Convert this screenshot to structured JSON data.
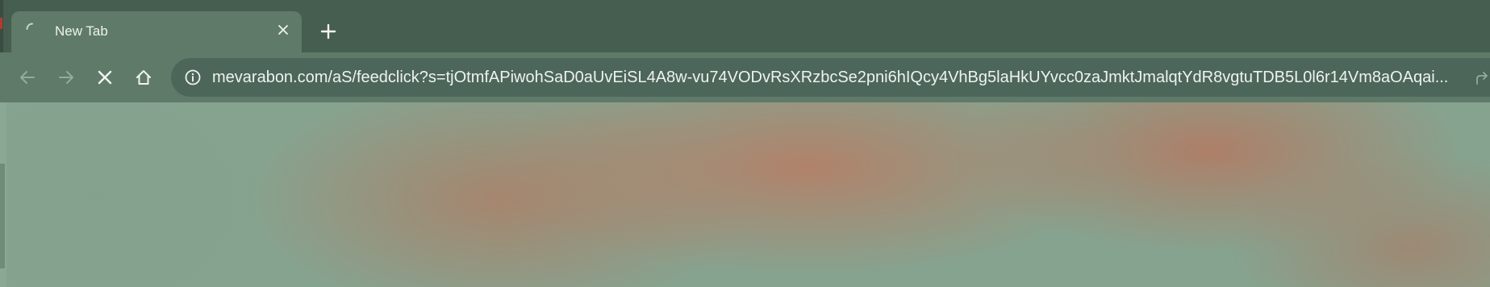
{
  "tab": {
    "title": "New Tab",
    "close_icon": "close-icon",
    "spinner_icon": "loading-spinner-icon"
  },
  "tabstrip": {
    "new_tab_icon": "plus-icon"
  },
  "toolbar": {
    "back_icon": "arrow-left-icon",
    "forward_icon": "arrow-right-icon",
    "stop_icon": "close-icon",
    "home_icon": "home-icon"
  },
  "omnibox": {
    "url": "mevarabon.com/aS/feedclick?s=tjOtmfAPiwohSaD0aUvEiSL4A8w-vu74VODvRsXRzbcSe2pni6hIQcy4VhBg5laHkUYvcc0zaJmktJmalqtYdR8vgtuTDB5L0l6r14Vm8aOAqai...",
    "info_icon": "info-icon"
  },
  "colors": {
    "tabstrip_bg": "#465e50",
    "tab_active_bg": "#5f7a69",
    "toolbar_bg": "#5f7a69",
    "omnibox_bg": "#4d665a",
    "content_green": "#86a38f",
    "content_rust": "#b07d66"
  }
}
